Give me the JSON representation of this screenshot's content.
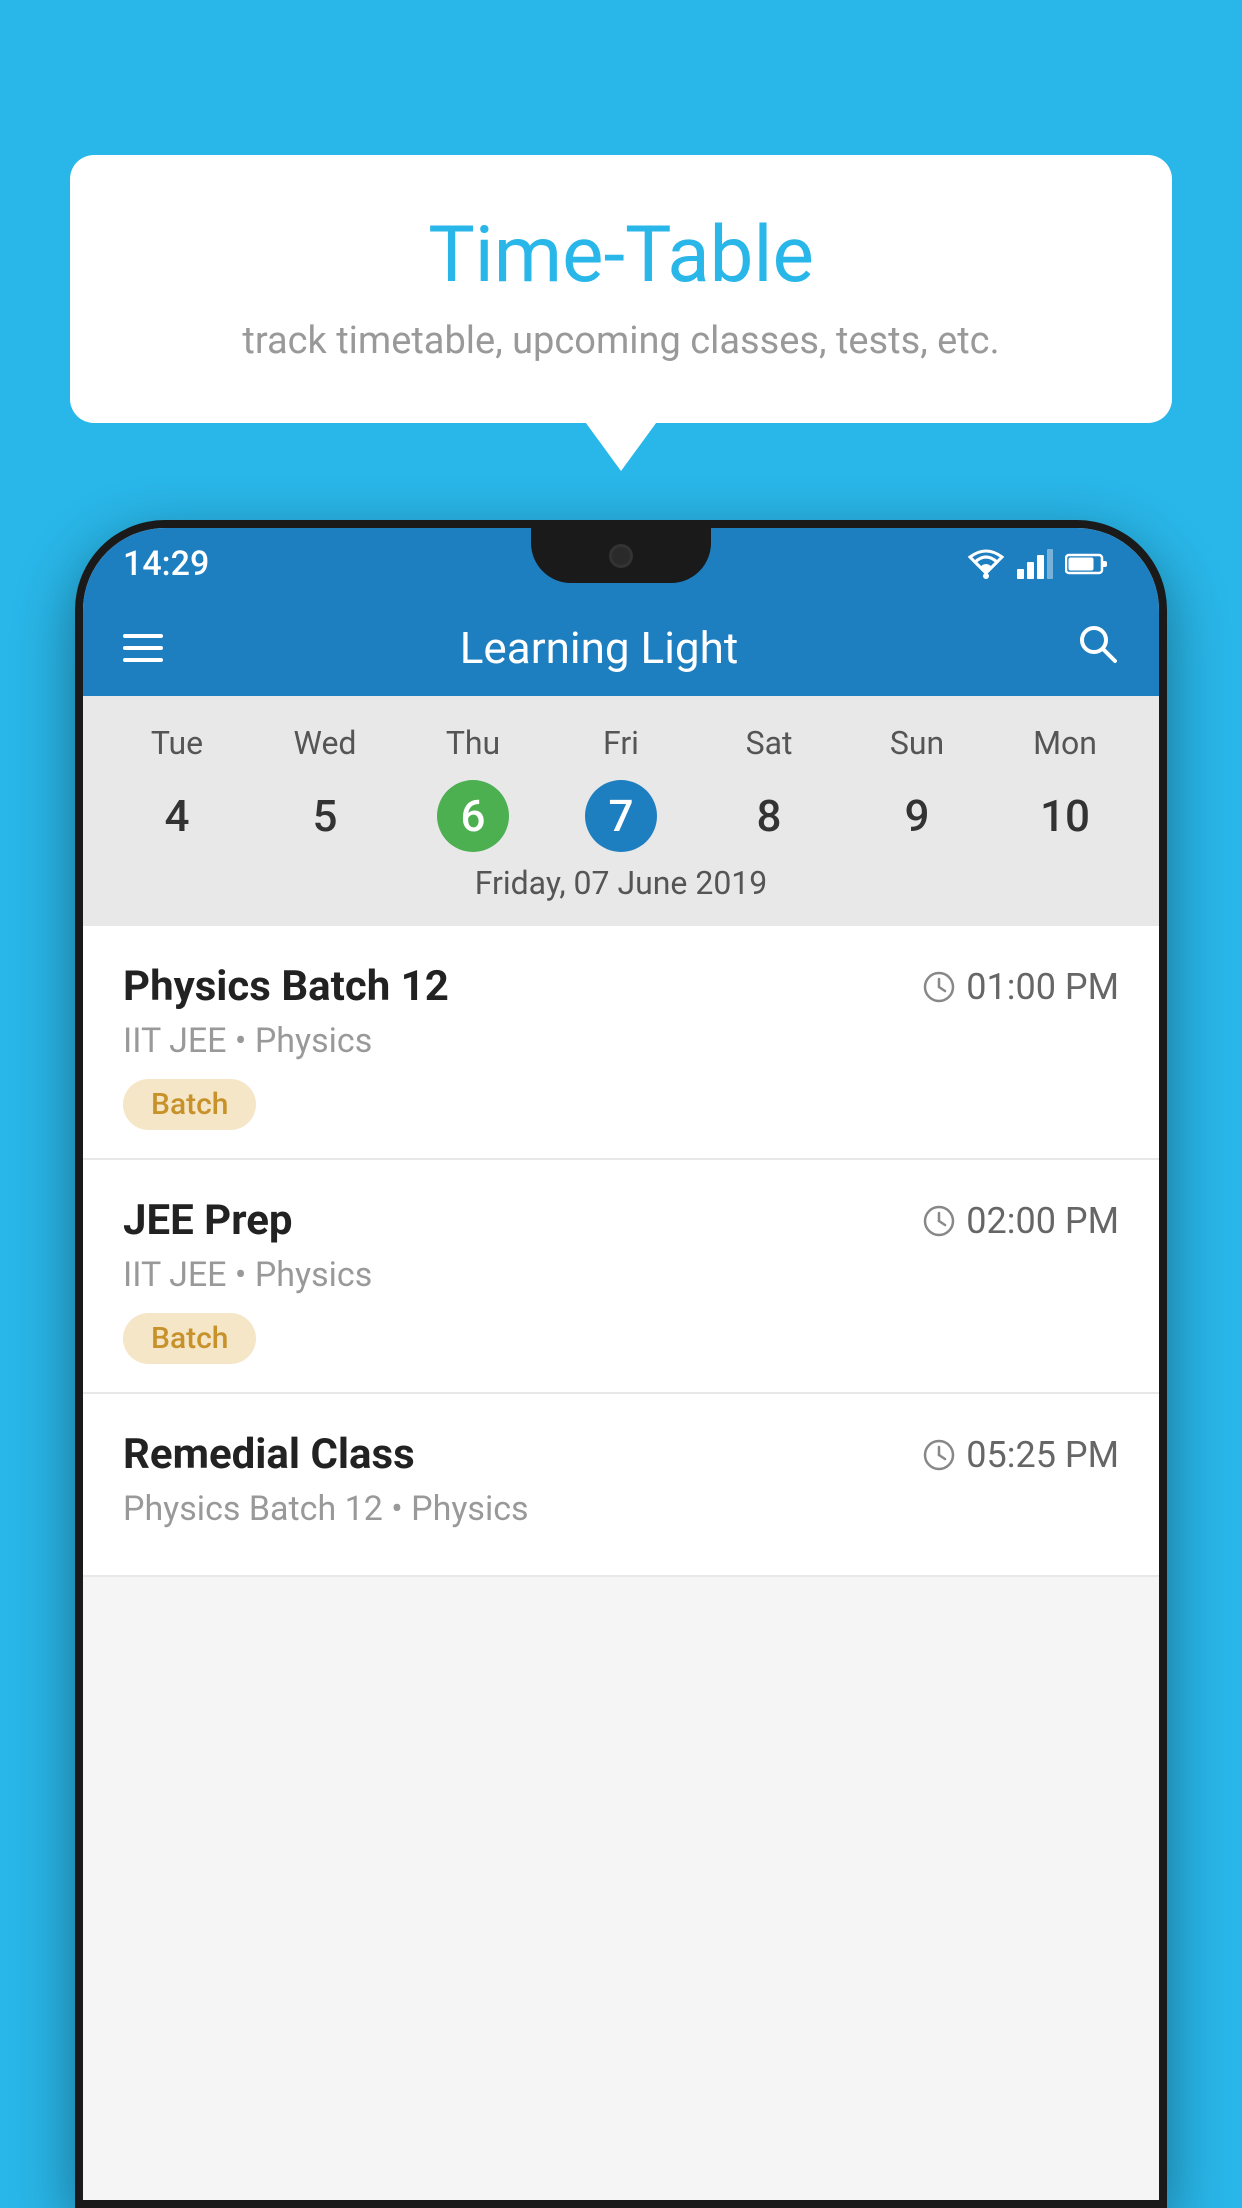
{
  "background_color": "#29b6e8",
  "tooltip": {
    "title": "Time-Table",
    "subtitle": "track timetable, upcoming classes, tests, etc."
  },
  "status_bar": {
    "time": "14:29"
  },
  "app_header": {
    "title": "Learning Light"
  },
  "calendar": {
    "days": [
      {
        "label": "Tue",
        "number": "4"
      },
      {
        "label": "Wed",
        "number": "5"
      },
      {
        "label": "Thu",
        "number": "6",
        "state": "today"
      },
      {
        "label": "Fri",
        "number": "7",
        "state": "selected"
      },
      {
        "label": "Sat",
        "number": "8"
      },
      {
        "label": "Sun",
        "number": "9"
      },
      {
        "label": "Mon",
        "number": "10"
      }
    ],
    "selected_date_label": "Friday, 07 June 2019"
  },
  "schedule": {
    "items": [
      {
        "title": "Physics Batch 12",
        "time": "01:00 PM",
        "subtitle": "IIT JEE • Physics",
        "tag": "Batch"
      },
      {
        "title": "JEE Prep",
        "time": "02:00 PM",
        "subtitle": "IIT JEE • Physics",
        "tag": "Batch"
      },
      {
        "title": "Remedial Class",
        "time": "05:25 PM",
        "subtitle": "Physics Batch 12 • Physics",
        "tag": null
      }
    ]
  }
}
